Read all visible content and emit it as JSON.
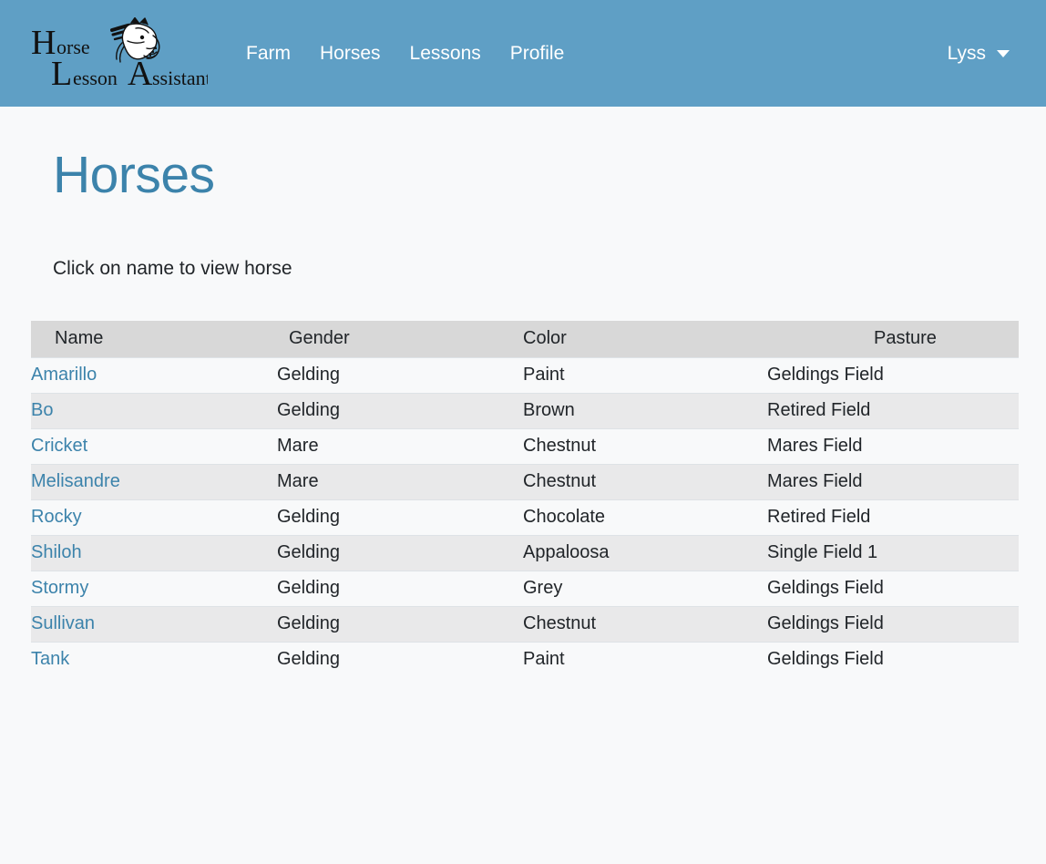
{
  "brand": {
    "line1": "Horse",
    "line2": "Lesson Assistant",
    "word1_cap": "H",
    "word1_rest": "orse",
    "word2_cap": "L",
    "word2_rest": "esson",
    "word3_cap": "A",
    "word3_rest": "ssistant",
    "icon": "horse-head-logo"
  },
  "navbar": {
    "background": "#5f9fc5",
    "links": [
      {
        "label": "Farm"
      },
      {
        "label": "Horses"
      },
      {
        "label": "Lessons"
      },
      {
        "label": "Profile"
      }
    ],
    "user": {
      "name": "Lyss",
      "caret": "chevron-down-icon"
    }
  },
  "page": {
    "title": "Horses",
    "title_color": "#3c83ab",
    "subtitle": "Click on name to view horse",
    "background": "#f8f9fa"
  },
  "table": {
    "header_background": "#d8d8d8",
    "stripe_background": "#e9e9ea",
    "link_color": "#3c83ab",
    "columns": [
      {
        "key": "name",
        "label": "Name"
      },
      {
        "key": "gender",
        "label": "Gender"
      },
      {
        "key": "color",
        "label": "Color"
      },
      {
        "key": "pasture",
        "label": "Pasture"
      }
    ],
    "rows": [
      {
        "name": "Amarillo",
        "gender": "Gelding",
        "color": "Paint",
        "pasture": "Geldings Field"
      },
      {
        "name": "Bo",
        "gender": "Gelding",
        "color": "Brown",
        "pasture": "Retired Field"
      },
      {
        "name": "Cricket",
        "gender": "Mare",
        "color": "Chestnut",
        "pasture": "Mares Field"
      },
      {
        "name": "Melisandre",
        "gender": "Mare",
        "color": "Chestnut",
        "pasture": "Mares Field"
      },
      {
        "name": "Rocky",
        "gender": "Gelding",
        "color": "Chocolate",
        "pasture": "Retired Field"
      },
      {
        "name": "Shiloh",
        "gender": "Gelding",
        "color": "Appaloosa",
        "pasture": "Single Field 1"
      },
      {
        "name": "Stormy",
        "gender": "Gelding",
        "color": "Grey",
        "pasture": "Geldings Field"
      },
      {
        "name": "Sullivan",
        "gender": "Gelding",
        "color": "Chestnut",
        "pasture": "Geldings Field"
      },
      {
        "name": "Tank",
        "gender": "Gelding",
        "color": "Paint",
        "pasture": "Geldings Field"
      }
    ]
  }
}
